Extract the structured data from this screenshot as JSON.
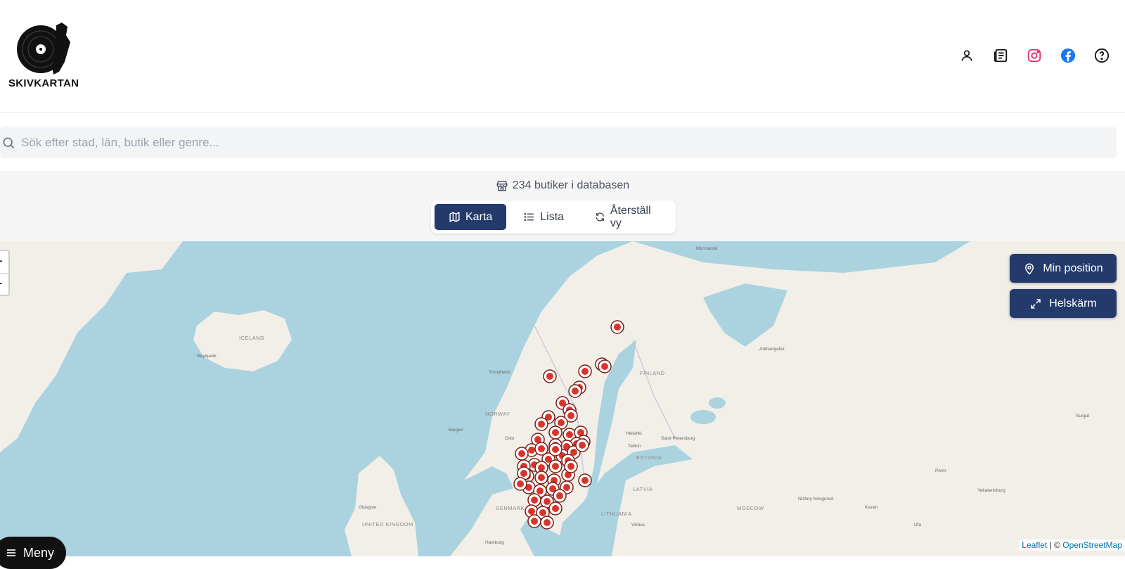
{
  "brand": {
    "name": "SKIVKARTAN"
  },
  "header_icons": [
    {
      "name": "user-icon",
      "color": "#111111"
    },
    {
      "name": "newspaper-icon",
      "color": "#111111"
    },
    {
      "name": "instagram-icon",
      "color": "#e1306c"
    },
    {
      "name": "facebook-icon",
      "color": "#1877f2"
    },
    {
      "name": "help-icon",
      "color": "#111111"
    }
  ],
  "search": {
    "placeholder": "Sök efter stad, län, butik eller genre...",
    "value": ""
  },
  "stats": {
    "count_text": "234 butiker i databasen"
  },
  "view_toggle": {
    "map_label": "Karta",
    "list_label": "Lista",
    "reset_label": "Återställ vy",
    "active": "Karta"
  },
  "map": {
    "zoom_in": "+",
    "zoom_out": "−",
    "my_position_label": "Min position",
    "fullscreen_label": "Helskärm",
    "attribution": {
      "leaflet": "Leaflet",
      "separator": " | © ",
      "osm": "OpenStreetMap"
    },
    "places": {
      "iceland": "ICELAND",
      "reykjavik": "Reykjavik",
      "norway": "NORWAY",
      "finland": "FINLAND",
      "estonia": "ESTONIA",
      "latvia": "LATVIA",
      "lithuania": "LITHUANIA",
      "denmark": "DENMARK",
      "united_kingdom": "UNITED KINGDOM",
      "murmansk": "Murmansk",
      "arkhangelsk": "Arkhangelsk",
      "trondheim": "Trondheim",
      "bergen": "Bergen",
      "oslo": "Oslo",
      "helsinki": "Helsinki",
      "tallinn": "Tallinn",
      "saint_petersburg": "Saint Petersburg",
      "moscow": "MOSCOW",
      "nizhny": "Nizhny Novgorod",
      "kazan": "Kazan",
      "perm": "Perm",
      "surgut": "Surgut",
      "yekaterinburg": "Yekaterinburg",
      "ufa": "Ufa",
      "glasgow": "Glasgow",
      "vilnius": "Vilnius",
      "hamburg": "Hamburg"
    },
    "marker_color": "#d9342b"
  },
  "menu": {
    "label": "Meny"
  }
}
